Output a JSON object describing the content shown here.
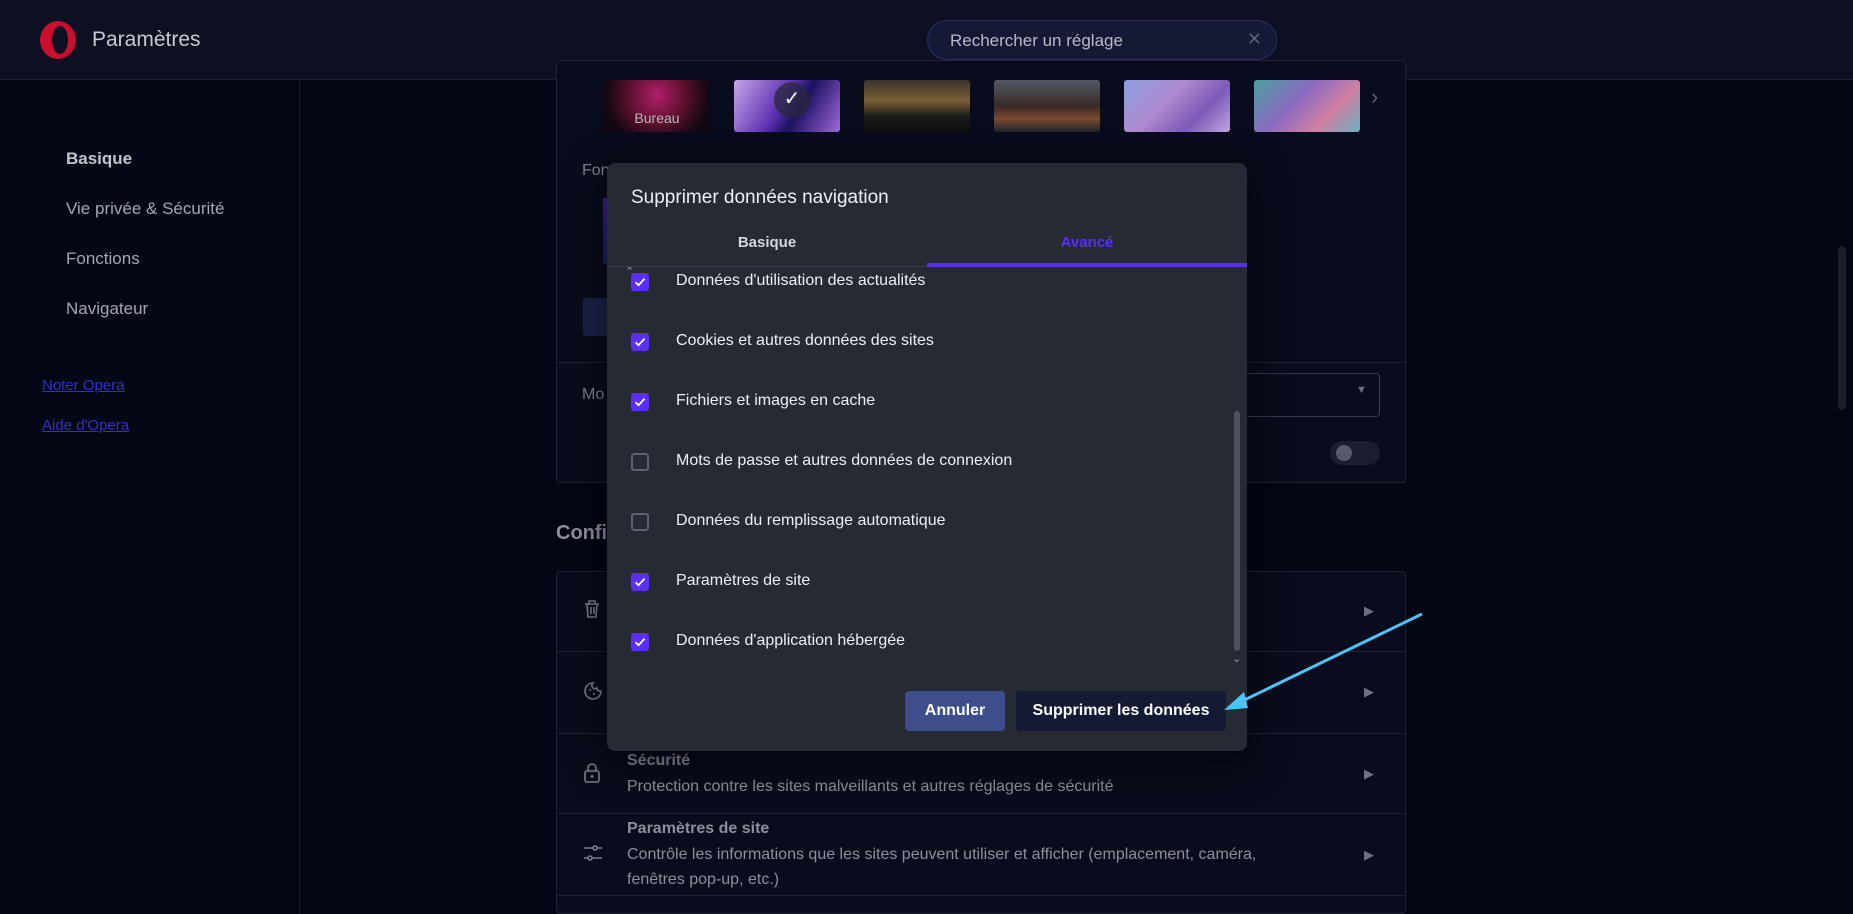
{
  "header": {
    "app_title": "Paramètres",
    "search_placeholder": "Rechercher un réglage",
    "search_clear_icon": "close-icon",
    "brand_color": "#c8102e"
  },
  "sidebar": {
    "items": [
      {
        "label": "Basique",
        "active": true
      },
      {
        "label": "Vie privée & Sécurité",
        "active": false
      },
      {
        "label": "Fonctions",
        "active": false
      },
      {
        "label": "Navigateur",
        "active": false
      }
    ],
    "links": [
      {
        "label": "Noter Opera"
      },
      {
        "label": "Aide d'Opera"
      }
    ]
  },
  "background": {
    "wallpaper_label": "Bureau",
    "fragment_fon": "Fon",
    "fragment_mo": "Mo",
    "section_title_fragment": "Confi",
    "rows": [
      {
        "icon": "trash-icon",
        "title": "",
        "desc": ""
      },
      {
        "icon": "cookie-icon",
        "title": "",
        "desc": ""
      },
      {
        "icon": "lock-icon",
        "title": "Sécurité",
        "desc": "Protection contre les sites malveillants et autres réglages de sécurité"
      },
      {
        "icon": "sliders-icon",
        "title": "Paramètres de site",
        "desc": "Contrôle les informations que les sites peuvent utiliser et afficher (emplacement, caméra, fenêtres pop-up, etc.)"
      }
    ]
  },
  "dialog": {
    "title": "Supprimer données navigation",
    "tabs": [
      {
        "label": "Basique",
        "active": false
      },
      {
        "label": "Avancé",
        "active": true
      }
    ],
    "options": [
      {
        "label": "Données d'utilisation des actualités",
        "checked": true
      },
      {
        "label": "Cookies et autres données des sites",
        "checked": true
      },
      {
        "label": "Fichiers et images en cache",
        "checked": true
      },
      {
        "label": "Mots de passe et autres données de connexion",
        "checked": false
      },
      {
        "label": "Données du remplissage automatique",
        "checked": false
      },
      {
        "label": "Paramètres de site",
        "checked": true
      },
      {
        "label": "Données d'application hébergée",
        "checked": true
      }
    ],
    "cancel_label": "Annuler",
    "confirm_label": "Supprimer les données",
    "accent_color": "#5b2ff7"
  },
  "annotation": {
    "arrow_color": "#4fc3f7"
  }
}
